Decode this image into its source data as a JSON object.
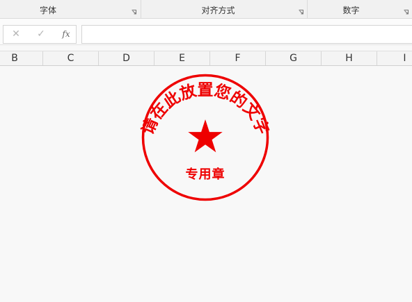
{
  "ribbon": {
    "groups": [
      {
        "label": "字体"
      },
      {
        "label": "对齐方式"
      },
      {
        "label": "数字"
      }
    ]
  },
  "formula_bar": {
    "cancel_glyph": "✕",
    "enter_glyph": "✓",
    "fx_label": "fx",
    "value": ""
  },
  "columns": [
    "B",
    "C",
    "D",
    "E",
    "F",
    "G",
    "H",
    "I"
  ],
  "seal": {
    "arc_text": "请在此放置您的文字",
    "bottom_text": "专用章",
    "color": "#ee0000",
    "center_icon": "star-icon"
  }
}
